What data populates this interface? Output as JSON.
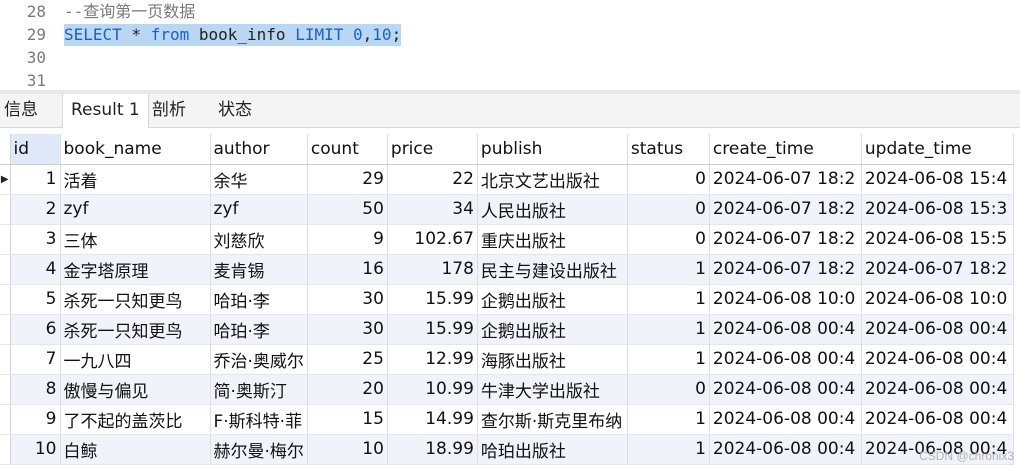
{
  "editor": {
    "lines": [
      {
        "no": "28",
        "text": "--查询第一页数据"
      },
      {
        "no": "29",
        "tokens": [
          "SELECT",
          " * ",
          "from",
          " book_info ",
          "LIMIT",
          " ",
          "0",
          ",",
          "10",
          ";"
        ]
      },
      {
        "no": "30",
        "text": ""
      },
      {
        "no": "31",
        "text": ""
      }
    ]
  },
  "tabs": [
    {
      "label": "信息"
    },
    {
      "label": "Result 1"
    },
    {
      "label": "剖析"
    },
    {
      "label": "状态"
    }
  ],
  "grid": {
    "row_marker": "▶",
    "columns": [
      "id",
      "book_name",
      "author",
      "count",
      "price",
      "publish",
      "status",
      "create_time",
      "update_time"
    ],
    "rows": [
      [
        "1",
        "活着",
        "余华",
        "29",
        "22",
        "北京文艺出版社",
        "0",
        "2024-06-07 18:2",
        "2024-06-08 15:4"
      ],
      [
        "2",
        "zyf",
        "zyf",
        "50",
        "34",
        "人民出版社",
        "0",
        "2024-06-07 18:2",
        "2024-06-08 15:3"
      ],
      [
        "3",
        "三体",
        "刘慈欣",
        "9",
        "102.67",
        "重庆出版社",
        "0",
        "2024-06-07 18:2",
        "2024-06-08 15:5"
      ],
      [
        "4",
        "金字塔原理",
        "麦肯锡",
        "16",
        "178",
        "民主与建设出版社",
        "1",
        "2024-06-07 18:2",
        "2024-06-07 18:2"
      ],
      [
        "5",
        "杀死一只知更鸟",
        "哈珀·李",
        "30",
        "15.99",
        "企鹅出版社",
        "1",
        "2024-06-08 10:0",
        "2024-06-08 10:0"
      ],
      [
        "6",
        "杀死一只知更鸟",
        "哈珀·李",
        "30",
        "15.99",
        "企鹅出版社",
        "1",
        "2024-06-08 00:4",
        "2024-06-08 00:4"
      ],
      [
        "7",
        "一九八四",
        "乔治·奥威尔",
        "25",
        "12.99",
        "海豚出版社",
        "1",
        "2024-06-08 00:4",
        "2024-06-08 00:4"
      ],
      [
        "8",
        "傲慢与偏见",
        "简·奥斯汀",
        "20",
        "10.99",
        "牛津大学出版社",
        "0",
        "2024-06-08 00:4",
        "2024-06-08 00:4"
      ],
      [
        "9",
        "了不起的盖茨比",
        "F·斯科特·菲",
        "15",
        "14.99",
        "查尔斯·斯克里布纳",
        "1",
        "2024-06-08 00:4",
        "2024-06-08 00:4"
      ],
      [
        "10",
        "白鲸",
        "赫尔曼·梅尔",
        "10",
        "18.99",
        "哈珀出版社",
        "1",
        "2024-06-08 00:4",
        "2024-06-08 00:4"
      ]
    ]
  },
  "watermark": "CSDN @chronix3",
  "colors": {
    "keyword": "#1a5fd0",
    "selection": "#b9d6f2",
    "alt_row": "#f0f4fa",
    "id_header": "#dfe9f7"
  }
}
